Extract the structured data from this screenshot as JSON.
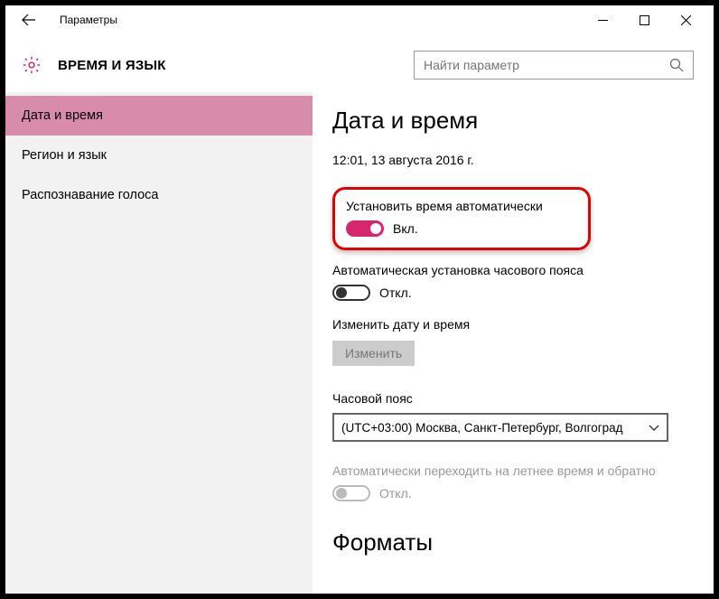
{
  "window": {
    "title": "Параметры"
  },
  "header": {
    "section": "ВРЕМЯ И ЯЗЫК"
  },
  "search": {
    "placeholder": "Найти параметр"
  },
  "sidebar": {
    "items": [
      {
        "label": "Дата и время",
        "active": true
      },
      {
        "label": "Регион и язык",
        "active": false
      },
      {
        "label": "Распознавание голоса",
        "active": false
      }
    ]
  },
  "main": {
    "heading": "Дата и время",
    "current_datetime": "12:01, 13 августа 2016 г.",
    "auto_time": {
      "label": "Установить время автоматически",
      "state_text": "Вкл.",
      "on": true
    },
    "auto_tz": {
      "label": "Автоматическая установка часового пояса",
      "state_text": "Откл.",
      "on": false
    },
    "change_block": {
      "label": "Изменить дату и время",
      "button": "Изменить"
    },
    "timezone": {
      "label": "Часовой пояс",
      "value": "(UTC+03:00) Москва, Санкт-Петербург, Волгоград"
    },
    "dst": {
      "label": "Автоматически переходить на летнее время и обратно",
      "state_text": "Откл.",
      "on": false,
      "disabled": true
    },
    "next_heading": "Форматы"
  }
}
